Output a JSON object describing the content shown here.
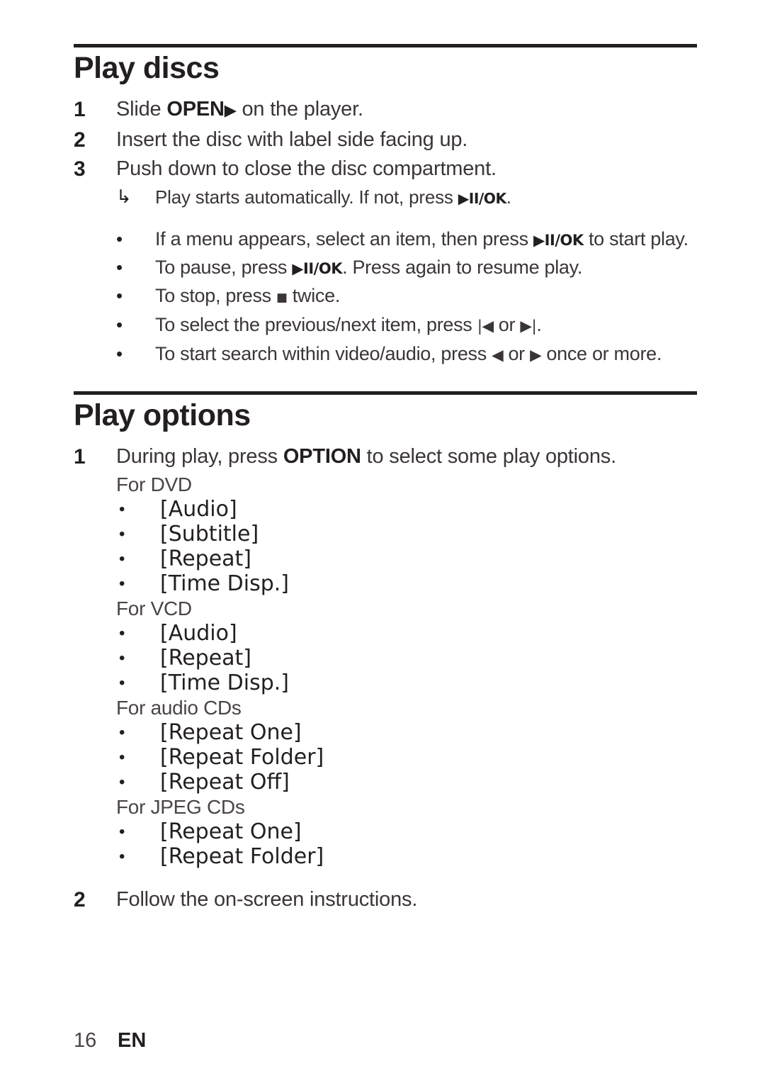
{
  "page": {
    "footer_page_number": "16",
    "footer_language": "EN"
  },
  "sections": [
    {
      "title": "Play discs",
      "steps": [
        {
          "number": "1",
          "text_before": "Slide ",
          "bold": "OPEN",
          "glyph": "▶",
          "text_after": " on the player."
        },
        {
          "number": "2",
          "text": "Insert the disc with label side facing up."
        },
        {
          "number": "3",
          "text": "Push down to close the disc compartment."
        }
      ],
      "result": {
        "marker": "↳",
        "text_before": "Play starts automatically. If not, press ",
        "glyph": "▶II/OK",
        "text_after": "."
      },
      "tips": [
        {
          "bullet": "•",
          "text_before": "If a menu appears, select an item, then press ",
          "glyph": "▶II/OK",
          "text_after": " to start play."
        },
        {
          "bullet": "•",
          "text_before": "To pause, press ",
          "glyph": "▶II/OK",
          "text_after": ". Press again to resume play."
        },
        {
          "bullet": "•",
          "text_before": "To stop, press ",
          "glyph": "■",
          "text_after": " twice."
        },
        {
          "bullet": "•",
          "text_before": "To select the previous/next item, press ",
          "glyph": "|◀",
          "text_mid": " or ",
          "glyph2": "▶|",
          "text_after": "."
        },
        {
          "bullet": "•",
          "text_before": "To start search within video/audio, press ",
          "glyph": "◀",
          "text_mid": " or ",
          "glyph2": "▶",
          "text_after": " once or more."
        }
      ]
    },
    {
      "title": "Play options",
      "step1": {
        "number": "1",
        "text_before": "During play, press ",
        "bold": "OPTION",
        "text_after": " to select some play options."
      },
      "option_groups": [
        {
          "label": "For DVD",
          "items": [
            "[Audio]",
            "[Subtitle]",
            "[Repeat]",
            "[Time Disp.]"
          ]
        },
        {
          "label": "For VCD",
          "items": [
            "[Audio]",
            "[Repeat]",
            "[Time Disp.]"
          ]
        },
        {
          "label": "For audio CDs",
          "items": [
            "[Repeat One]",
            "[Repeat Folder]",
            "[Repeat Off]"
          ]
        },
        {
          "label": "For JPEG CDs",
          "items": [
            "[Repeat One]",
            "[Repeat Folder]"
          ]
        }
      ],
      "bullet_char": "•",
      "step2": {
        "number": "2",
        "text": "Follow the on-screen instructions."
      }
    }
  ]
}
